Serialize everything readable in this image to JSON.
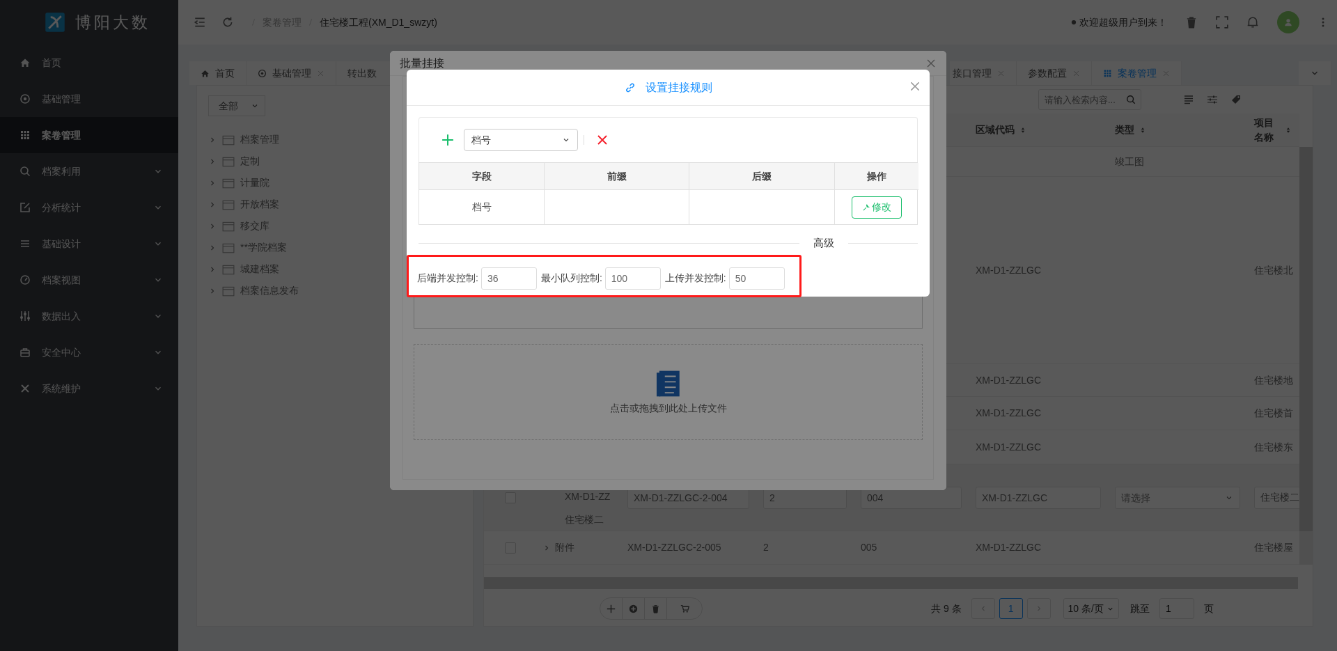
{
  "sidebar": {
    "logo_text": "博阳大数",
    "items": [
      {
        "label": "首页",
        "expandable": false,
        "selected": false
      },
      {
        "label": "基础管理",
        "expandable": false,
        "selected": false
      },
      {
        "label": "案卷管理",
        "expandable": false,
        "selected": true
      },
      {
        "label": "档案利用",
        "expandable": true,
        "selected": false
      },
      {
        "label": "分析统计",
        "expandable": true,
        "selected": false
      },
      {
        "label": "基础设计",
        "expandable": true,
        "selected": false
      },
      {
        "label": "档案视图",
        "expandable": true,
        "selected": false
      },
      {
        "label": "数据出入",
        "expandable": true,
        "selected": false
      },
      {
        "label": "安全中心",
        "expandable": true,
        "selected": false
      },
      {
        "label": "系统维护",
        "expandable": true,
        "selected": false
      }
    ]
  },
  "header": {
    "breadcrumb": [
      "案卷管理",
      "住宅楼工程(XM_D1_swzyt)"
    ],
    "welcome": "欢迎超级用户到来！"
  },
  "tabs": [
    {
      "label": "首页",
      "closable": false,
      "selected": false
    },
    {
      "label": "基础管理",
      "closable": true,
      "selected": false
    },
    {
      "label": "转出数",
      "closable": false,
      "selected": false
    },
    {
      "label": "接口管理",
      "closable": true,
      "selected": false
    },
    {
      "label": "参数配置",
      "closable": true,
      "selected": false
    },
    {
      "label": "案卷管理",
      "closable": true,
      "selected": true
    }
  ],
  "tree": {
    "filter": "全部",
    "items": [
      {
        "label": "档案管理",
        "expanded": false
      },
      {
        "label": "定制",
        "expanded": false
      },
      {
        "label": "计量院",
        "expanded": false
      },
      {
        "label": "开放档案",
        "expanded": false
      },
      {
        "label": "移交库",
        "expanded": false
      },
      {
        "label": "**学院档案",
        "expanded": false
      },
      {
        "label": "城建档案",
        "expanded": false
      },
      {
        "label": "档案信息发布",
        "expanded": false
      }
    ]
  },
  "table": {
    "search_placeholder": "请输入检索内容...",
    "columns": [
      "区域代码",
      "类型",
      "项目名称"
    ],
    "rows": [
      {
        "kind": "view",
        "type": "竣工图"
      },
      {
        "kind": "view",
        "region_code": "XM-D1-ZZLGC",
        "project_name": "住宅楼北"
      },
      {
        "kind": "view",
        "region_code": "XM-D1-ZZLGC",
        "project_name": "住宅楼地"
      },
      {
        "kind": "view",
        "region_code": "XM-D1-ZZLGC",
        "project_name": "住宅楼首"
      },
      {
        "kind": "view",
        "region_code": "XM-D1-ZZLGC",
        "project_name": "住宅楼东"
      },
      {
        "kind": "edit",
        "checked": false,
        "name_lines": [
          "XM-D1-ZZ",
          "住宅楼二"
        ],
        "code": "XM-D1-ZZLGC-2-004",
        "column_4": "2",
        "column_5": "004",
        "region_code": "XM-D1-ZZLGC",
        "type_placeholder": "请选择",
        "project_name": "住宅楼二"
      },
      {
        "kind": "view",
        "checked": false,
        "expanded": false,
        "name": "附件",
        "code": "XM-D1-ZZLGC-2-005",
        "column_4": "2",
        "column_5": "005",
        "region_code": "XM-D1-ZZLGC",
        "project_name": "住宅楼屋"
      }
    ]
  },
  "pagination": {
    "total": "共 9 条",
    "pages": [
      {
        "label": "1",
        "selected": true
      }
    ],
    "page_size": "10 条/页",
    "jump_label": "跳至",
    "jump_value": "1",
    "page_suffix": "页"
  },
  "outer_dialog": {
    "title": "批量挂接",
    "upload_text": "点击或拖拽到此处上传文件"
  },
  "rule_dialog": {
    "title": "设置挂接规则",
    "field_select": "档号",
    "rule_table": {
      "columns": [
        "字段",
        "前缀",
        "后缀",
        "操作"
      ],
      "rows": [
        {
          "field": "档号",
          "action": "修改"
        }
      ]
    },
    "section_title": "高级",
    "settings": [
      {
        "label": "后端并发控制:",
        "value": "36"
      },
      {
        "label": "最小队列控制:",
        "value": "100"
      },
      {
        "label": "上传并发控制:",
        "value": "50"
      }
    ]
  }
}
